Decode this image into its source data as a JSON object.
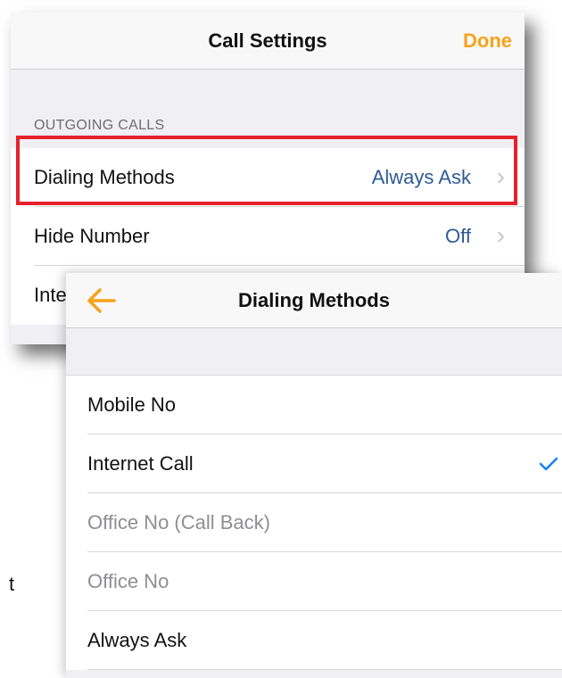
{
  "call_settings": {
    "title": "Call Settings",
    "done_label": "Done",
    "section_header": "OUTGOING CALLS",
    "rows": [
      {
        "label": "Dialing Methods",
        "value": "Always Ask"
      },
      {
        "label": "Hide Number",
        "value": "Off"
      },
      {
        "label": "Inte",
        "value": ""
      }
    ]
  },
  "dialing_methods": {
    "title": "Dialing Methods",
    "options": [
      {
        "label": "Mobile No",
        "selected": false,
        "enabled": true
      },
      {
        "label": "Internet Call",
        "selected": true,
        "enabled": true
      },
      {
        "label": "Office No (Call Back)",
        "selected": false,
        "enabled": false
      },
      {
        "label": "Office No",
        "selected": false,
        "enabled": false
      },
      {
        "label": "Always Ask",
        "selected": false,
        "enabled": true
      }
    ]
  },
  "stray_text": "t",
  "colors": {
    "accent": "#f5a31a",
    "value_text": "#2e5b95",
    "check": "#1a7ff2",
    "highlight": "#e5222b"
  },
  "icons": {
    "back": "arrow-left-icon",
    "chevron": "chevron-right-icon",
    "check": "checkmark-icon"
  }
}
